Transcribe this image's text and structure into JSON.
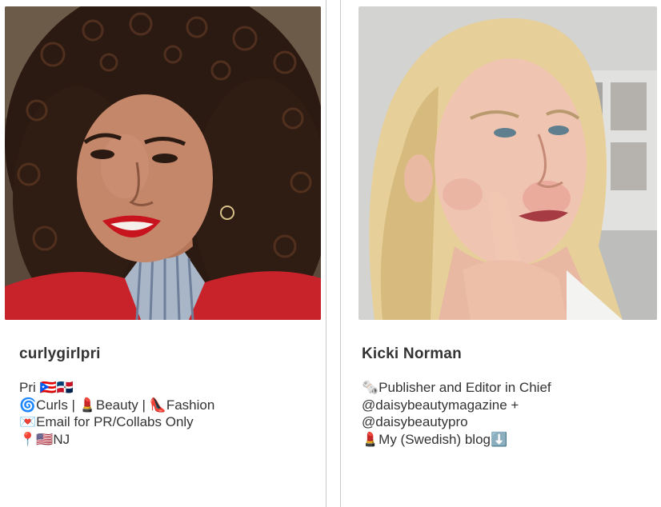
{
  "profiles": [
    {
      "name": "curlygirlpri",
      "bio": [
        "Pri 🇵🇷🇩🇴",
        "🌀Curls | 💄Beauty | 👠Fashion",
        "💌Email for PR/Collabs Only",
        "📍🇺🇸NJ"
      ]
    },
    {
      "name": "Kicki Norman",
      "bio": [
        "🗞️Publisher and Editor in Chief",
        "@daisybeautymagazine +",
        "@daisybeautypro",
        "💄My (Swedish) blog⬇️"
      ]
    }
  ],
  "colors": {
    "divider": "#c9c9c9",
    "text": "#333333",
    "left_photo_bg": "#4a3a30",
    "left_jacket": "#c8232a",
    "right_photo_bg": "#cfcfcd",
    "right_hair": "#e6cf98"
  }
}
